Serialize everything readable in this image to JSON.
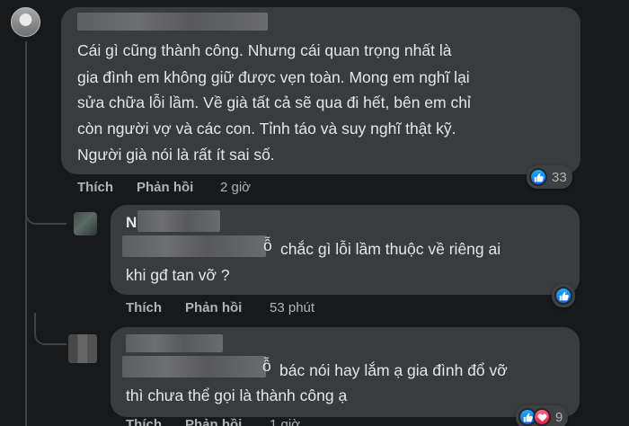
{
  "comments": [
    {
      "author_visible": "",
      "text_lines": [
        "Cái gì cũng thành công. Nhưng cái quan trọng nhất là",
        "gia đình em không giữ được vẹn toàn. Mong em nghĩ lại",
        "sửa chữa lỗi lầm. Về già tất cả sẽ qua đi hết, bên em chỉ",
        "còn người vợ và các con. Tỉnh táo và suy nghĩ thật kỹ.",
        "Người già nói là rất ít sai số."
      ],
      "like_label": "Thích",
      "reply_label": "Phản hồi",
      "time": "2 giờ",
      "reaction_count": "33",
      "reactions": [
        "like"
      ]
    },
    {
      "author_visible": "N",
      "text_lines": [
        "chắc gì lỗi lầm thuộc về riêng ai",
        "khi gđ tan vỡ ?"
      ],
      "line1_visible_prefix": "ỗ",
      "like_label": "Thích",
      "reply_label": "Phản hồi",
      "time": "53 phút",
      "reactions": [
        "like"
      ]
    },
    {
      "author_visible": "",
      "text_lines": [
        "bác nói hay lắm ạ gia đình đổ vỡ",
        "thì chưa thể gọi là thành công ạ"
      ],
      "line1_visible_prefix": "ỗ",
      "like_label": "Thích",
      "reply_label": "Phản hồi",
      "time": "1 giờ",
      "reaction_count": "9",
      "reactions": [
        "like",
        "love"
      ]
    }
  ],
  "colors": {
    "background": "#18191a",
    "bubble": "#3a3b3c",
    "text": "#e4e6eb",
    "secondary": "#b0b3b8",
    "like_blue": "#0866ff",
    "love_red": "#e61e4d"
  }
}
